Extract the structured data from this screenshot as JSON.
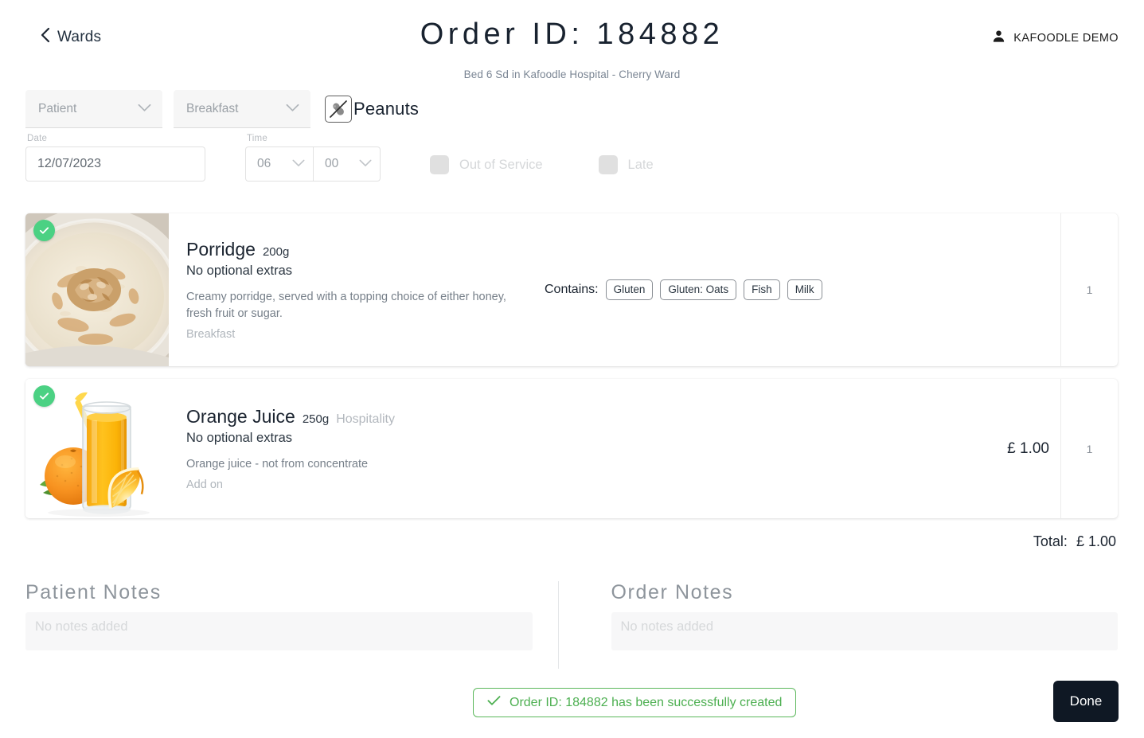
{
  "header": {
    "back_label": "Wards",
    "back_icon": "chevron-left-icon",
    "title": "Order ID: 184882",
    "subtitle": "Bed 6 Sd in Kafoodle Hospital - Cherry Ward",
    "user_name": "KAFOODLE DEMO",
    "user_icon": "person-icon"
  },
  "filters": {
    "patient_select": {
      "value": "Patient",
      "icon": "chevron-down-icon"
    },
    "meal_select": {
      "value": "Breakfast",
      "icon": "chevron-down-icon"
    },
    "allergen": {
      "label": "Peanuts",
      "icon": "peanut-crossed-icon"
    },
    "date": {
      "label": "Date",
      "value": "12/07/2023"
    },
    "time": {
      "label": "Time",
      "hour": "06",
      "minute": "00",
      "icon": "chevron-down-icon"
    },
    "out_of_service": {
      "label": "Out of Service",
      "checked": false
    },
    "late": {
      "label": "Late",
      "checked": false
    }
  },
  "items": [
    {
      "image": "porridge-image",
      "selected_icon": "check-circle-icon",
      "name": "Porridge",
      "weight": "200g",
      "tagword": "",
      "extras": "No optional extras",
      "description": "Creamy porridge, served with a topping choice of either honey, fresh fruit or sugar.",
      "course": "Breakfast",
      "contains_label": "Contains:",
      "allergens": [
        "Gluten",
        "Gluten: Oats",
        "Fish",
        "Milk"
      ],
      "price": "",
      "qty": "1"
    },
    {
      "image": "orange-juice-image",
      "selected_icon": "check-circle-icon",
      "name": "Orange Juice",
      "weight": "250g",
      "tagword": "Hospitality",
      "extras": "No optional extras",
      "description": "Orange juice - not from concentrate",
      "course": "Add on",
      "contains_label": "",
      "allergens": [],
      "price": "£ 1.00",
      "qty": "1"
    }
  ],
  "totals": {
    "label": "Total:",
    "amount": "£ 1.00"
  },
  "notes": {
    "patient": {
      "title": "Patient Notes",
      "value": "No notes added"
    },
    "order": {
      "title": "Order Notes",
      "value": "No notes added"
    }
  },
  "footer": {
    "toast": {
      "icon": "check-icon",
      "message": "Order ID: 184882 has been successfully created"
    },
    "done_label": "Done"
  },
  "colors": {
    "accent_dark": "#0f1824",
    "success_green": "#4caf50",
    "badge_green": "#4bd183",
    "muted_text": "#9aa0a6"
  }
}
